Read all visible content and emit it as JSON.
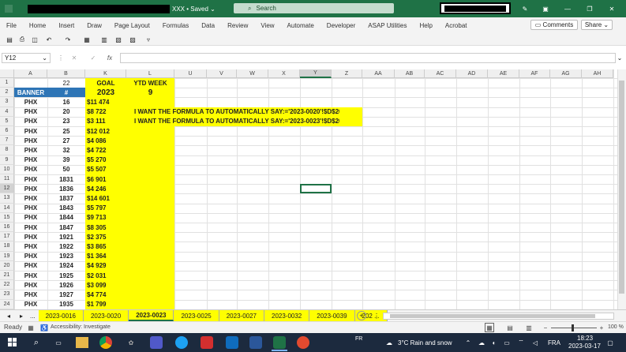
{
  "titlebar": {
    "doc_title": "XXX • Saved",
    "search_placeholder": "Search"
  },
  "ribbon": {
    "tabs": [
      "File",
      "Home",
      "Insert",
      "Draw",
      "Page Layout",
      "Formulas",
      "Data",
      "Review",
      "View",
      "Automate",
      "Developer",
      "ASAP Utilities",
      "Help",
      "Acrobat"
    ],
    "comments": "Comments",
    "share": "Share"
  },
  "formula_bar": {
    "name_box": "Y12",
    "fx": "fx",
    "formula": ""
  },
  "columns": [
    "A",
    "B",
    "K",
    "L",
    "U",
    "V",
    "W",
    "X",
    "Y",
    "Z",
    "AA",
    "AB",
    "AC",
    "AD",
    "AE",
    "AF",
    "AG",
    "AH"
  ],
  "row_numbers": [
    "1",
    "2",
    "3",
    "4",
    "5",
    "6",
    "7",
    "8",
    "9",
    "10",
    "11",
    "12",
    "13",
    "14",
    "15",
    "16",
    "17",
    "18",
    "19",
    "20",
    "21",
    "22",
    "23",
    "24"
  ],
  "cells": {
    "b1": "22",
    "k1": "GOAL",
    "l1": "YTD WEEK",
    "a2": "BANNER",
    "b2": "#",
    "k2": "2023",
    "l2": "9",
    "note1": "I WANT THE FORMULA TO AUTOMATICALLY SAY:='2023-0020'!$D$20",
    "note2": "I WANT THE FORMULA TO AUTOMATICALLY SAY:='2023-0023'!$D$20"
  },
  "data_rows": [
    [
      "PHX",
      "16",
      "$11 474"
    ],
    [
      "PHX",
      "20",
      "$8 722"
    ],
    [
      "PHX",
      "23",
      "$3 111"
    ],
    [
      "PHX",
      "25",
      "$12 012"
    ],
    [
      "PHX",
      "27",
      "$4 086"
    ],
    [
      "PHX",
      "32",
      "$4 722"
    ],
    [
      "PHX",
      "39",
      "$5 270"
    ],
    [
      "PHX",
      "50",
      "$5 507"
    ],
    [
      "PHX",
      "1831",
      "$6 901"
    ],
    [
      "PHX",
      "1836",
      "$4 246"
    ],
    [
      "PHX",
      "1837",
      "$14 601"
    ],
    [
      "PHX",
      "1843",
      "$5 797"
    ],
    [
      "PHX",
      "1844",
      "$9 713"
    ],
    [
      "PHX",
      "1847",
      "$8 305"
    ],
    [
      "PHX",
      "1921",
      "$2 375"
    ],
    [
      "PHX",
      "1922",
      "$3 865"
    ],
    [
      "PHX",
      "1923",
      "$1 364"
    ],
    [
      "PHX",
      "1924",
      "$4 929"
    ],
    [
      "PHX",
      "1925",
      "$2 031"
    ],
    [
      "PHX",
      "1926",
      "$3 099"
    ],
    [
      "PHX",
      "1927",
      "$4 774"
    ],
    [
      "PHX",
      "1935",
      "$1 799"
    ]
  ],
  "sheet_tabs": [
    "...",
    "2023-0016",
    "2023-0020",
    "2023-0023",
    "2023-0025",
    "2023-0027",
    "2023-0032",
    "2023-0039",
    "202 ..."
  ],
  "active_sheet": "2023-0023",
  "status": {
    "ready": "Ready",
    "accessibility": "Accessibility: Investigate",
    "zoom": "100 %"
  },
  "taskbar": {
    "weather": "3°C  Rain and snow",
    "lang_input": "FR",
    "lang": "FRA",
    "time": "18:23",
    "date": "2023-03-17"
  },
  "colors": {
    "excel_green": "#1f7246",
    "yellow": "#ffff00",
    "header_blue": "#2e75b6",
    "taskbar": "#1c2a3e"
  }
}
